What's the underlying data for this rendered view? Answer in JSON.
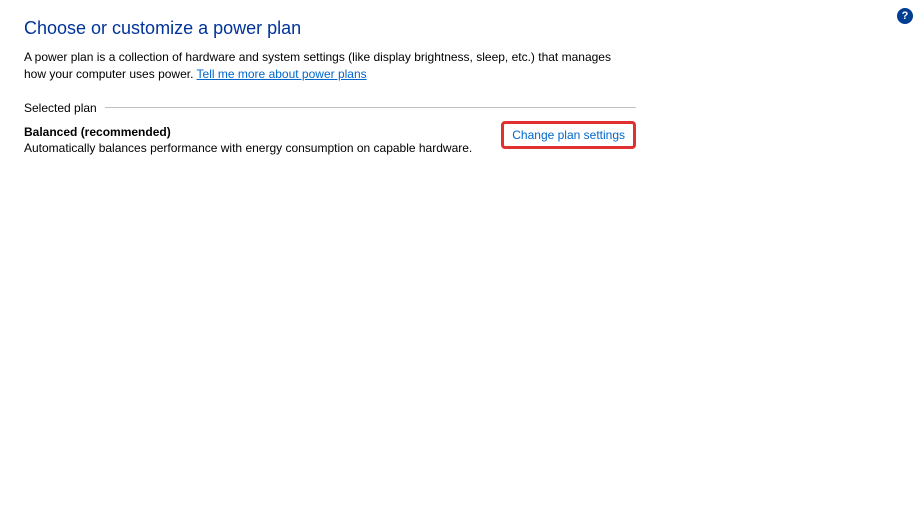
{
  "header": {
    "title": "Choose or customize a power plan",
    "description_prefix": "A power plan is a collection of hardware and system settings (like display brightness, sleep, etc.) that manages how your computer uses power. ",
    "learn_more_link": "Tell me more about power plans"
  },
  "section": {
    "label": "Selected plan"
  },
  "plan": {
    "name": "Balanced (recommended)",
    "description": "Automatically balances performance with energy consumption on capable hardware.",
    "change_link": "Change plan settings"
  },
  "help": {
    "symbol": "?"
  }
}
